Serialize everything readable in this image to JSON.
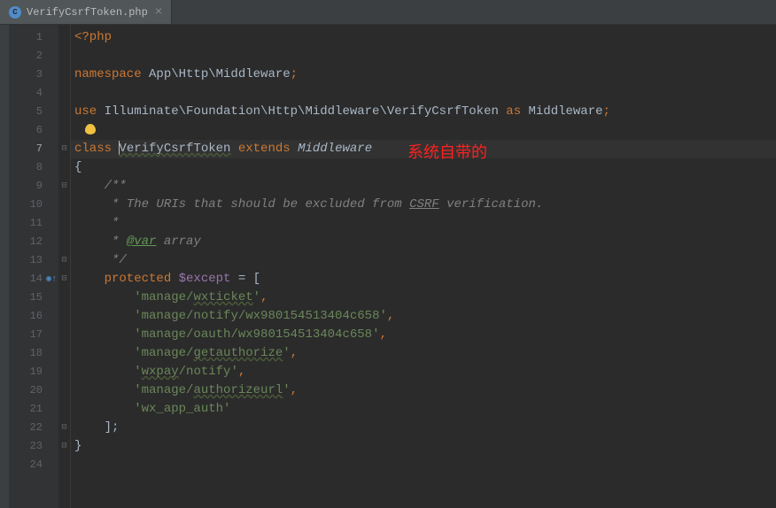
{
  "tab": {
    "label": "VerifyCsrfToken.php",
    "icon_letter": "C"
  },
  "annotation": "系统自带的",
  "code": {
    "l1_open": "<?php",
    "l3_kw": "namespace ",
    "l3_ns": "App\\Http\\Middleware",
    "l5_kw_use": "use ",
    "l5_ns": "Illuminate\\Foundation\\Http\\Middleware\\VerifyCsrfToken",
    "l5_as": " as ",
    "l5_alias": "Middleware",
    "l7_kw_class": "class ",
    "l7_name": "VerifyCsrfToken",
    "l7_extends": " extends ",
    "l7_parent": "Middleware",
    "l8_brace": "{",
    "l9_cmt": "    /**",
    "l10_cmt_a": "     * The URIs that should be excluded from ",
    "l10_csrf": "CSRF",
    "l10_cmt_b": " verification.",
    "l11_cmt": "     *",
    "l12_cmt_a": "     * ",
    "l12_tag": "@var",
    "l12_cmt_b": " array",
    "l13_cmt": "     */",
    "l14_kw": "    protected ",
    "l14_var": "$except",
    "l14_eq": " = [",
    "l15_a": "        '",
    "l15_b": "manage/",
    "l15_c": "wxticket",
    "l15_d": "'",
    "l15_e": ",",
    "l16_a": "        '",
    "l16_b": "manage/notify/wx980154513404c658",
    "l16_c": "',",
    "l17_a": "        '",
    "l17_b": "manage/oauth/wx980154513404c658",
    "l17_c": "',",
    "l18_a": "        '",
    "l18_b": "manage/",
    "l18_c": "getauthorize",
    "l18_d": "',",
    "l19_a": "        '",
    "l19_b": "wxpay",
    "l19_c": "/notify",
    "l19_d": "',",
    "l20_a": "        '",
    "l20_b": "manage/",
    "l20_c": "authorizeurl",
    "l20_d": "',",
    "l21_a": "        '",
    "l21_b": "wx_app_auth",
    "l21_c": "'",
    "l22_close": "    ];",
    "l23_brace": "}"
  },
  "line_numbers": [
    "1",
    "2",
    "3",
    "4",
    "5",
    "6",
    "7",
    "8",
    "9",
    "10",
    "11",
    "12",
    "13",
    "14",
    "15",
    "16",
    "17",
    "18",
    "19",
    "20",
    "21",
    "22",
    "23",
    "24"
  ]
}
